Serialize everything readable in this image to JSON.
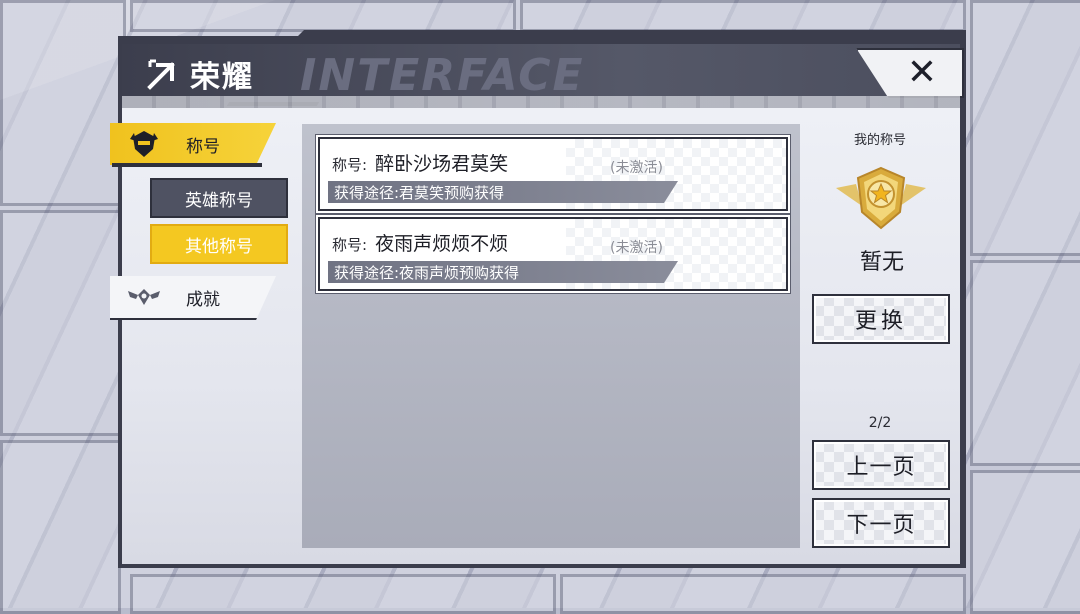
{
  "screen": {
    "title": "荣耀",
    "header_watermark": "INTERFACE"
  },
  "nav": {
    "titles_tab": {
      "label": "称号",
      "icon": "helmet-icon",
      "active": true
    },
    "hero_titles": {
      "label": "英雄称号"
    },
    "other_titles": {
      "label": "其他称号",
      "active": true
    },
    "achievements_tab": {
      "label": "成就",
      "icon": "winged-emblem-icon"
    }
  },
  "titles": [
    {
      "prefix": "称号:",
      "name": "醉卧沙场君莫笑",
      "status": "(未激活)",
      "source": "获得途径:君莫笑预购获得"
    },
    {
      "prefix": "称号:",
      "name": "夜雨声烦烦不烦",
      "status": "(未激活)",
      "source": "获得途径:夜雨声烦预购获得"
    }
  ],
  "sidebar": {
    "my_title_label": "我的称号",
    "badge_icon": "star-badge-icon",
    "current_title": "暂无",
    "change_button": "更换",
    "page_indicator": "2/2",
    "prev_button": "上一页",
    "next_button": "下一页"
  },
  "colors": {
    "accent_gold": "#f4c821",
    "frame_dark": "#3b3d4c",
    "text_dark": "#1d1e26"
  }
}
